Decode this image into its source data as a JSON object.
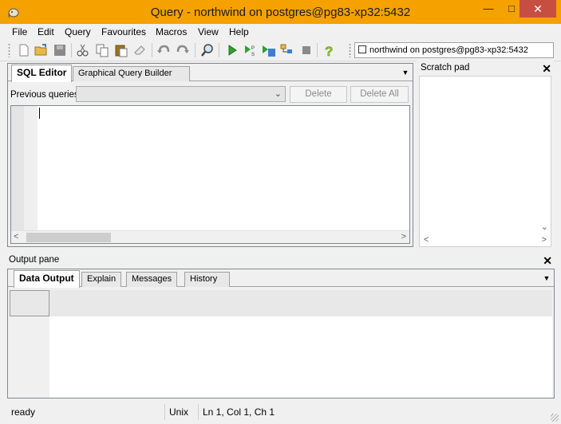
{
  "window": {
    "title": "Query - northwind on postgres@pg83-xp32:5432",
    "minimize": "—",
    "maximize": "□",
    "close": "✕"
  },
  "menu": [
    "File",
    "Edit",
    "Query",
    "Favourites",
    "Macros",
    "View",
    "Help"
  ],
  "toolbar": {
    "icons": [
      "new-file-icon",
      "open-folder-icon",
      "save-icon",
      "cut-icon",
      "copy-icon",
      "paste-icon",
      "clear-icon",
      "undo-icon",
      "redo-icon",
      "find-icon",
      "execute-icon",
      "explain-icon",
      "execute-to-file-icon",
      "explain-analyze-icon",
      "cancel-icon",
      "help-icon"
    ],
    "connection": "northwind on postgres@pg83-xp32:5432"
  },
  "editor": {
    "tabs": [
      "SQL Editor",
      "Graphical Query Builder"
    ],
    "previous_queries_label": "Previous queries",
    "delete_label": "Delete",
    "delete_all_label": "Delete All"
  },
  "scratch": {
    "title": "Scratch pad"
  },
  "output": {
    "title": "Output pane",
    "tabs": [
      "Data Output",
      "Explain",
      "Messages",
      "History"
    ]
  },
  "status": {
    "state": "ready",
    "line_endings": "Unix",
    "position": "Ln 1, Col 1, Ch 1"
  }
}
